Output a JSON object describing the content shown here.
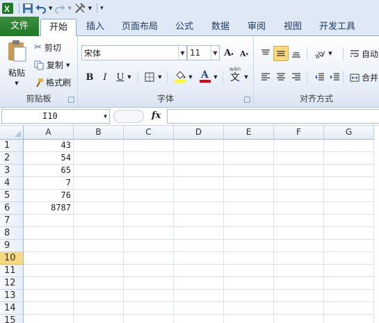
{
  "qat": {
    "icons": [
      "excel-logo",
      "save-icon",
      "undo-icon",
      "redo-icon",
      "tools-icon",
      "customize-icon"
    ]
  },
  "tabs": [
    {
      "label": "文件"
    },
    {
      "label": "开始"
    },
    {
      "label": "插入"
    },
    {
      "label": "页面布局"
    },
    {
      "label": "公式"
    },
    {
      "label": "数据"
    },
    {
      "label": "审阅"
    },
    {
      "label": "视图"
    },
    {
      "label": "开发工具"
    }
  ],
  "clipboard": {
    "paste": "粘贴",
    "cut": "剪切",
    "copy": "复制",
    "format_painter": "格式刷",
    "group": "剪贴板"
  },
  "font": {
    "name": "宋体",
    "size": "11",
    "bold": "B",
    "italic": "I",
    "underline": "U",
    "group": "字体",
    "phonetic": "wén",
    "phonetic2": "文"
  },
  "alignment": {
    "group": "对齐方式",
    "wrap": "自动",
    "merge": "合并"
  },
  "formula_bar": {
    "name_box": "I10",
    "fx": "fx",
    "formula": ""
  },
  "columns": [
    "A",
    "B",
    "C",
    "D",
    "E",
    "F",
    "G"
  ],
  "rows": [
    "1",
    "2",
    "3",
    "4",
    "5",
    "6",
    "7",
    "8",
    "9",
    "10",
    "11",
    "12",
    "13",
    "14",
    "15"
  ],
  "selected_row": "10",
  "cells_A": [
    "43",
    "54",
    "65",
    "7",
    "76",
    "8787",
    "",
    "",
    "",
    "",
    "",
    "",
    "",
    "",
    ""
  ],
  "colors": {
    "file_tab": "#2a7f30",
    "selection": "#f9d97f",
    "font_color": "#e8000b",
    "highlight": "#ffff00"
  }
}
